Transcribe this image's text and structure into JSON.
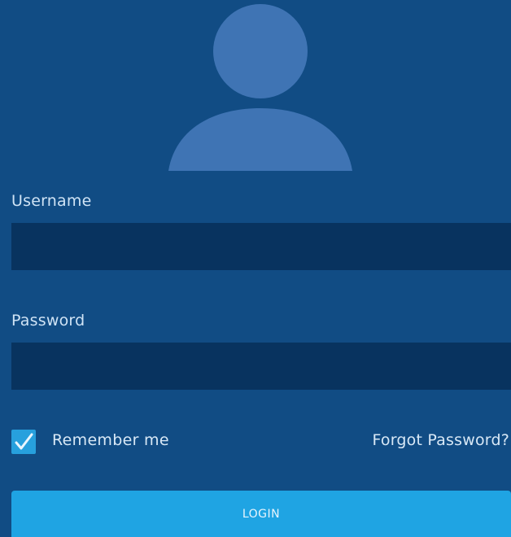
{
  "avatar": {
    "icon": "user-icon",
    "color": "#3f74b4"
  },
  "form": {
    "username_label": "Username",
    "username_value": "",
    "password_label": "Password",
    "password_value": "",
    "remember_label": "Remember me",
    "remember_checked": true,
    "forgot_label": "Forgot Password?",
    "login_label": "LOGIN"
  },
  "colors": {
    "background": "#114c84",
    "input_background": "#08335f",
    "accent": "#1fa4e3",
    "checkbox": "#27a0dd"
  }
}
